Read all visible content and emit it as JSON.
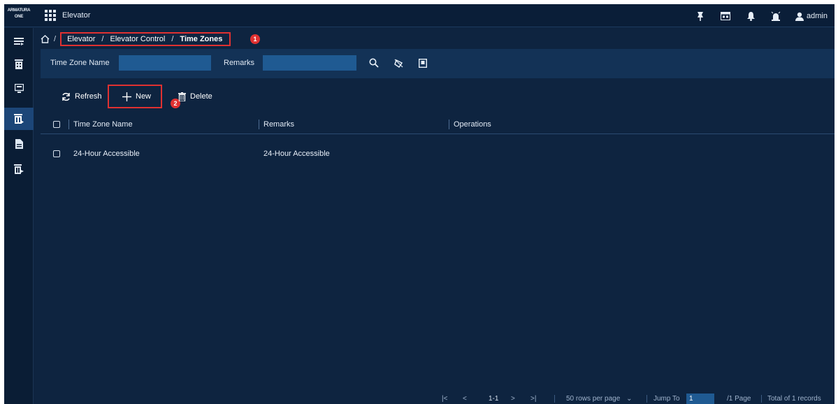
{
  "app": {
    "brand_line1": "ARMATURA",
    "brand_line2": "ONE",
    "module_title": "Elevator",
    "user_name": "admin"
  },
  "topbar_icons": [
    "pin-icon",
    "dashboard-icon",
    "bell-icon",
    "alarm-icon",
    "user-icon"
  ],
  "sidenav": {
    "items": [
      {
        "icon": "menu-list-icon"
      },
      {
        "icon": "building-icon"
      },
      {
        "icon": "monitor-icon"
      },
      {
        "icon": "elevator-icon",
        "active": true
      },
      {
        "icon": "document-icon"
      },
      {
        "icon": "report-icon"
      }
    ]
  },
  "breadcrumb": {
    "home_icon": "home-icon",
    "sep": "/",
    "items": [
      "Elevator",
      "Elevator Control",
      "Time Zones"
    ],
    "badge": "1"
  },
  "filter": {
    "time_zone_name_label": "Time Zone Name",
    "time_zone_name_value": "",
    "remarks_label": "Remarks",
    "remarks_value": ""
  },
  "toolbar": {
    "refresh_label": "Refresh",
    "new_label": "New",
    "delete_label": "Delete",
    "badge": "2"
  },
  "table": {
    "columns": [
      "Time Zone Name",
      "Remarks",
      "Operations"
    ],
    "rows": [
      {
        "name": "24-Hour Accessible",
        "remarks": "24-Hour Accessible",
        "operations": ""
      }
    ]
  },
  "pagination": {
    "first": "|<",
    "prev": "<",
    "range": "1-1",
    "next": ">",
    "last": ">|",
    "rows_per_page": "50 rows per page",
    "jump_label": "Jump To",
    "jump_value": "1",
    "page_total": "/1 Page",
    "record_total": "Total of 1 records"
  },
  "colors": {
    "background": "#0e2440",
    "topbar": "#0a1e38",
    "filter_bar": "#133256",
    "input": "#1f5a92",
    "active_nav": "#1c4678",
    "annotation_red": "#e03131"
  }
}
